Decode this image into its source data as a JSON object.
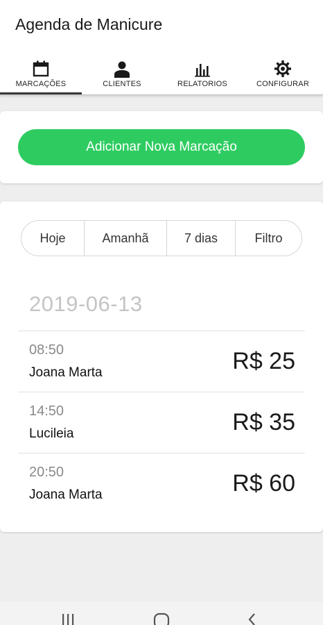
{
  "header": {
    "title": "Agenda de Manicure"
  },
  "tabs": [
    {
      "label": "MARCAÇÕES",
      "icon": "calendar-icon",
      "active": true
    },
    {
      "label": "CLIENTES",
      "icon": "person-icon",
      "active": false
    },
    {
      "label": "RELATORIOS",
      "icon": "bar-chart-icon",
      "active": false
    },
    {
      "label": "CONFIGURAR",
      "icon": "gear-icon",
      "active": false
    }
  ],
  "add_card": {
    "button_label": "Adicionar Nova Marcação"
  },
  "filters": [
    {
      "label": "Hoje"
    },
    {
      "label": "Amanhã"
    },
    {
      "label": "7 dias"
    },
    {
      "label": "Filtro"
    }
  ],
  "appointments": {
    "date": "2019-06-13",
    "items": [
      {
        "time": "08:50",
        "client": "Joana Marta",
        "price": "R$ 25"
      },
      {
        "time": "14:50",
        "client": "Lucileia",
        "price": "R$ 35"
      },
      {
        "time": "20:50",
        "client": "Joana Marta",
        "price": "R$ 60"
      }
    ]
  },
  "navbar": {
    "buttons": [
      "recent-apps-icon",
      "home-icon",
      "back-icon"
    ]
  },
  "colors": {
    "accent": "#2ecc60",
    "background": "#eeeeee",
    "card": "#ffffff",
    "date_text": "#c4c4c4",
    "time_text": "#8a8a8a"
  }
}
